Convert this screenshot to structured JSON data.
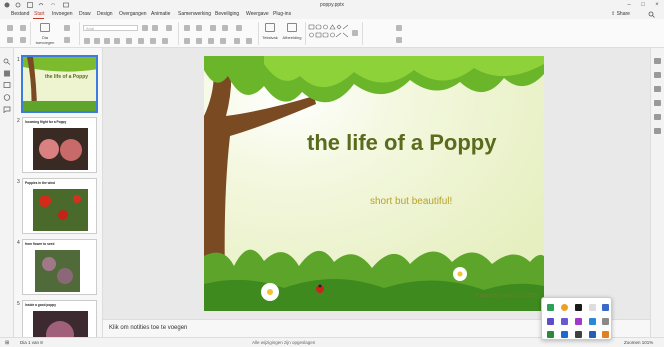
{
  "window": {
    "title": "poppy.pptx"
  },
  "menu": {
    "items": [
      "Bestand",
      "Start",
      "Invoegen",
      "Draw",
      "Design",
      "Overgangen",
      "Animatie",
      "Samenwerking",
      "Beveiliging",
      "Weergave",
      "Plug-ins"
    ],
    "active": "Start",
    "share_label": "Share"
  },
  "ribbon": {
    "paste_label": "Dia toevoegen",
    "textbox_label": "Tekstvak",
    "image_label": "Afbeelding",
    "font_placeholder": "Arial"
  },
  "thumbnails": [
    {
      "num": "1",
      "title": "the life of a Poppy"
    },
    {
      "num": "2",
      "title": "Incoming flight for a Poppy"
    },
    {
      "num": "3",
      "title": "Poppies in the wind"
    },
    {
      "num": "4",
      "title": "from flower to seed"
    },
    {
      "num": "5",
      "title": "Inside a good poppy"
    }
  ],
  "slide": {
    "title": "the life of a Poppy",
    "subtitle": "short but beautiful!",
    "caption": "Created by Tom & Co. 2015"
  },
  "notes": {
    "placeholder": "Klik om notities toe te voegen"
  },
  "status": {
    "slide_info": "Dia 1 van 8",
    "saved": "Alle wijzigingen zijn opgeslagen",
    "zoom": "Zoomen 101%"
  },
  "colors": {
    "accent": "#c0392b",
    "title_green": "#5a6b1e",
    "subtitle_gold": "#b8a12a",
    "selection": "#3b7ddd"
  }
}
